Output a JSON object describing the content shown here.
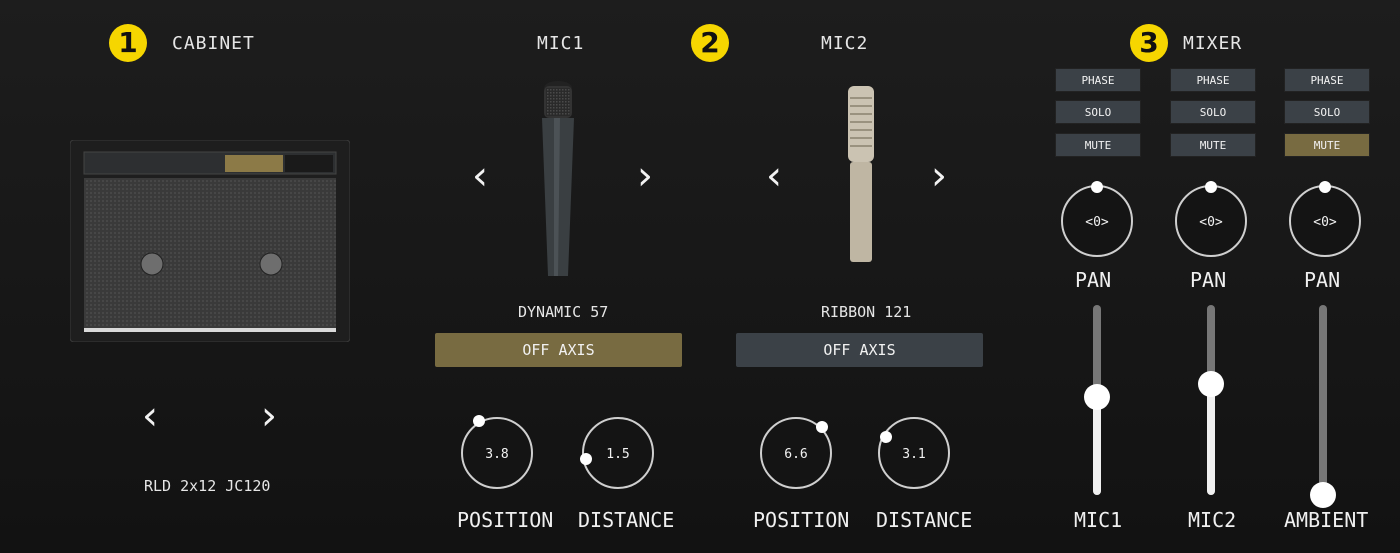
{
  "cabinet": {
    "badge": "1",
    "title": "CABINET",
    "name": "RLD 2x12 JC120",
    "prev_icon": "chevron-left-icon",
    "next_icon": "chevron-right-icon"
  },
  "mic1": {
    "title": "MIC1",
    "badge": "2",
    "name": "DYNAMIC 57",
    "off_axis_label": "OFF AXIS",
    "off_axis_on": true,
    "position": {
      "label": "POSITION",
      "value": "3.8"
    },
    "distance": {
      "label": "DISTANCE",
      "value": "1.5"
    }
  },
  "mic2": {
    "title": "MIC2",
    "name": "RIBBON 121",
    "off_axis_label": "OFF AXIS",
    "off_axis_on": false,
    "position": {
      "label": "POSITION",
      "value": "6.6"
    },
    "distance": {
      "label": "DISTANCE",
      "value": "3.1"
    }
  },
  "mixer": {
    "badge": "3",
    "title": "MIXER",
    "channels": [
      {
        "name": "MIC1",
        "phase": "PHASE",
        "solo": "SOLO",
        "mute": "MUTE",
        "mute_on": false,
        "pan_value": "<0>",
        "pan_label": "PAN",
        "fader_level": 0.55
      },
      {
        "name": "MIC2",
        "phase": "PHASE",
        "solo": "SOLO",
        "mute": "MUTE",
        "mute_on": false,
        "pan_value": "<0>",
        "pan_label": "PAN",
        "fader_level": 0.61
      },
      {
        "name": "AMBIENT",
        "phase": "PHASE",
        "solo": "SOLO",
        "mute": "MUTE",
        "mute_on": true,
        "pan_value": "<0>",
        "pan_label": "PAN",
        "fader_level": 0.0
      }
    ]
  },
  "colors": {
    "accent_on": "#786b41",
    "button_off": "#3b4147",
    "badge": "#f6d600"
  }
}
